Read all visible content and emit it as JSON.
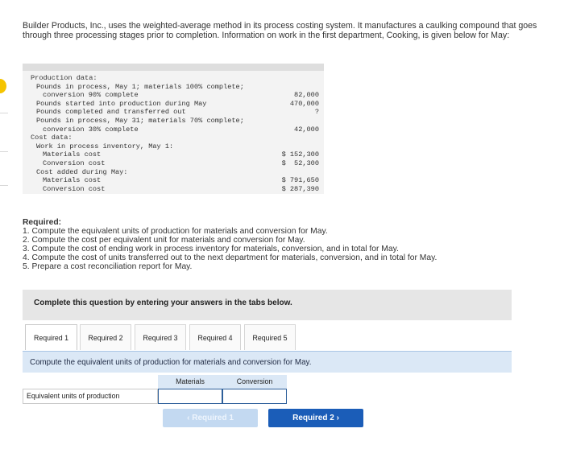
{
  "intro": "Builder Products, Inc., uses the weighted-average method in its process costing system. It manufactures a caulking compound that goes through three processing stages prior to completion. Information on work in the first department, Cooking, is given below for May:",
  "data_rows": [
    {
      "label": "Production data:",
      "indent": 0,
      "value": ""
    },
    {
      "label": "Pounds in process, May 1; materials 100% complete;",
      "indent": 1,
      "value": ""
    },
    {
      "label": "conversion 90% complete",
      "indent": 2,
      "value": "82,000"
    },
    {
      "label": "Pounds started into production during May",
      "indent": 1,
      "value": "470,000"
    },
    {
      "label": "Pounds completed and transferred out",
      "indent": 1,
      "value": "?"
    },
    {
      "label": "Pounds in process, May 31; materials 70% complete;",
      "indent": 1,
      "value": ""
    },
    {
      "label": "conversion 30% complete",
      "indent": 2,
      "value": "42,000"
    },
    {
      "label": "Cost data:",
      "indent": 0,
      "value": ""
    },
    {
      "label": "Work in process inventory, May 1:",
      "indent": 1,
      "value": ""
    },
    {
      "label": "Materials cost",
      "indent": 2,
      "value": "$ 152,300"
    },
    {
      "label": "Conversion cost",
      "indent": 2,
      "value": "$  52,300"
    },
    {
      "label": "Cost added during May:",
      "indent": 1,
      "value": ""
    },
    {
      "label": "Materials cost",
      "indent": 2,
      "value": "$ 791,650"
    },
    {
      "label": "Conversion cost",
      "indent": 2,
      "value": "$ 287,390"
    }
  ],
  "required": {
    "heading": "Required:",
    "items": [
      "1. Compute the equivalent units of production for materials and conversion for May.",
      "2. Compute the cost per equivalent unit for materials and conversion for May.",
      "3. Compute the cost of ending work in process inventory for materials, conversion, and in total for May.",
      "4. Compute the cost of units transferred out to the next department for materials, conversion, and in total for May.",
      "5. Prepare a cost reconciliation report for May."
    ]
  },
  "banner": "Complete this question by entering your answers in the tabs below.",
  "tabs": [
    {
      "label": "Required 1",
      "active": true
    },
    {
      "label": "Required 2",
      "active": false
    },
    {
      "label": "Required 3",
      "active": false
    },
    {
      "label": "Required 4",
      "active": false
    },
    {
      "label": "Required 5",
      "active": false
    }
  ],
  "question": "Compute the equivalent units of production for materials and conversion for May.",
  "table": {
    "columns": [
      "Materials",
      "Conversion"
    ],
    "row_label": "Equivalent units of production",
    "materials_value": "",
    "conversion_value": ""
  },
  "nav": {
    "prev_label": "Required 1",
    "next_label": "Required 2",
    "prev_icon": "chevron-left-icon",
    "next_icon": "chevron-right-icon"
  },
  "colors": {
    "accent": "#1b5db8",
    "accent_disabled": "#c3d9f1",
    "question_bar": "#dbe8f6",
    "banner": "#e6e6e6"
  }
}
